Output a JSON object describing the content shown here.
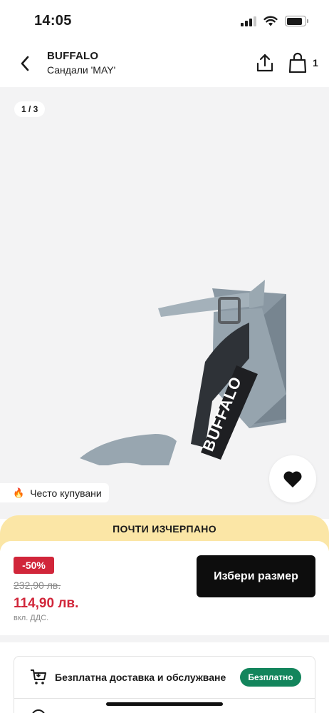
{
  "status_bar": {
    "time": "14:05",
    "icons": [
      "cellular-signal-icon",
      "wifi-icon",
      "battery-icon"
    ],
    "battery_level": 0.85
  },
  "header": {
    "back_icon": "chevron-left-icon",
    "brand": "BUFFALO",
    "product": "Сандали 'MAY'",
    "share_icon": "share-icon",
    "bag_icon": "shopping-bag-icon",
    "bag_count": "1"
  },
  "gallery": {
    "page_indicator": "1 / 3",
    "image_alt": "denim-platform-sandal",
    "image_brand_text": "BUFFALO",
    "wishlist_icon": "heart-icon",
    "popular_icon": "flame-icon",
    "popular_label": "Често купувани",
    "background": "#f3f3f4"
  },
  "purchase": {
    "stock_banner": "ПОЧТИ ИЗЧЕРПАНО",
    "discount": "-50%",
    "old_price": "232,90 лв.",
    "new_price": "114,90 лв.",
    "vat_note": "вкл. ДДС.",
    "select_size_button": "Избери размер"
  },
  "info_card": {
    "delivery_icon": "cart-icon",
    "delivery_label": "Безплатна доставка и обслужване",
    "delivery_badge": "Безплатно",
    "next_row_icon": "info-icon"
  },
  "colors": {
    "accent_red": "#d1263a",
    "banner_yellow": "#fbe6a6",
    "badge_green": "#13855c",
    "button_black": "#0d0d0d"
  }
}
